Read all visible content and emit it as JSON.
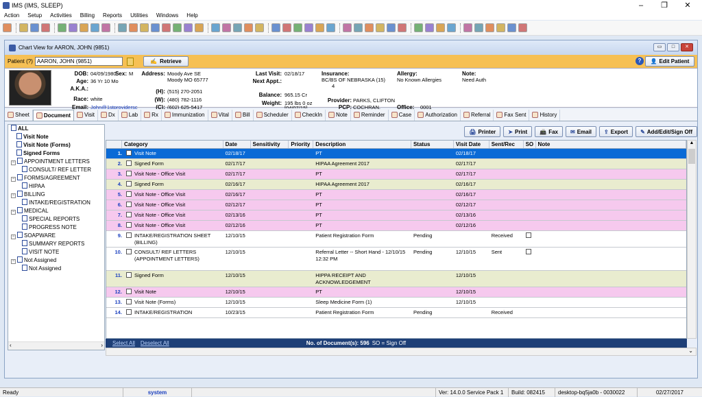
{
  "app": {
    "title": "IMS (IMS, SLEEP)"
  },
  "menu": [
    "Action",
    "Setup",
    "Activities",
    "Billing",
    "Reports",
    "Utilities",
    "Windows",
    "Help"
  ],
  "chart": {
    "title": "Chart View for AARON, JOHN  (9851)",
    "patient_label": "Patient (?)",
    "patient_value": "AARON, JOHN  (9851)",
    "retrieve": "Retrieve",
    "help": "?",
    "edit_patient": "Edit Patient"
  },
  "demo": {
    "dob_l": "DOB:",
    "dob": "04/09/1980",
    "sex_l": "Sex:",
    "sex": "M",
    "age_l": "Age:",
    "age": "36 Yr 10 Mo",
    "aka_l": "A.K.A.:",
    "race_l": "Race:",
    "race": "white",
    "email_l": "Email:",
    "email": "John@1stprovidersc",
    "addr_l": "Address:",
    "addr1": "Moody Ave SE",
    "addr2": "Moody  MO  65777",
    "h_l": "(H):",
    "h": "(515) 270-2051",
    "w_l": "(W):",
    "w": "(480) 782-1116",
    "c_l": "(C):",
    "c": "(602) 625-5417",
    "lv_l": "Last Visit:",
    "lv": "02/18/17",
    "na_l": "Next Appt.:",
    "bal_l": "Balance:",
    "bal": "965.15 Cr",
    "wt_l": "Weight:",
    "wt": "195 lbs 0 oz",
    "wt2": "[04/07/15]",
    "ins_l": "Insurance:",
    "ins": "BC/BS OF NEBRASKA  (15)",
    "ins2": "4",
    "prov_l": "Provider:",
    "prov": "PARKS, CLIFTON",
    "pcp_l": "PCP:",
    "pcp": "COCHRAN,",
    "office_l": "Office:",
    "office": "0001",
    "all_l": "Allergy:",
    "all": "No Known Allergies",
    "note_l": "Note:",
    "note": "Need Auth"
  },
  "tabs": [
    "Sheet",
    "Document",
    "Visit",
    "Dx",
    "Lab",
    "Rx",
    "Immunization",
    "Vital",
    "Bill",
    "Scheduler",
    "CheckIn",
    "Note",
    "Reminder",
    "Case",
    "Authorization",
    "Referral",
    "Fax Sent",
    "History"
  ],
  "tree": [
    {
      "t": "ALL",
      "b": true,
      "l": 0,
      "e": false
    },
    {
      "t": "Visit Note",
      "b": true,
      "l": 1,
      "e": false
    },
    {
      "t": "Visit Note (Forms)",
      "b": true,
      "l": 1,
      "e": false
    },
    {
      "t": "Signed Forms",
      "b": true,
      "l": 1,
      "e": false
    },
    {
      "t": "APPOINTMENT LETTERS",
      "b": false,
      "l": 0,
      "e": true
    },
    {
      "t": "CONSULT/ REF LETTER",
      "b": false,
      "l": 2,
      "e": false
    },
    {
      "t": "FORMS/AGREEMENT",
      "b": false,
      "l": 0,
      "e": true
    },
    {
      "t": "HIPAA",
      "b": false,
      "l": 2,
      "e": false
    },
    {
      "t": "BILLING",
      "b": false,
      "l": 0,
      "e": true
    },
    {
      "t": "INTAKE/REGISTRATION",
      "b": false,
      "l": 2,
      "e": false
    },
    {
      "t": "MEDICAL",
      "b": false,
      "l": 0,
      "e": true
    },
    {
      "t": "SPECIAL REPORTS",
      "b": false,
      "l": 2,
      "e": false
    },
    {
      "t": "PROGRESS NOTE",
      "b": false,
      "l": 2,
      "e": false
    },
    {
      "t": "SOAPWARE",
      "b": false,
      "l": 0,
      "e": true
    },
    {
      "t": "SUMMARY REPORTS",
      "b": false,
      "l": 2,
      "e": false
    },
    {
      "t": "VISIT NOTE",
      "b": false,
      "l": 2,
      "e": false
    },
    {
      "t": "Not Assigned",
      "b": false,
      "l": 0,
      "e": true
    },
    {
      "t": "Not Assigned",
      "b": false,
      "l": 2,
      "e": false
    }
  ],
  "actions": [
    "Printer",
    "Print",
    "Fax",
    "Email",
    "Export",
    "Add/Edit/Sign Off"
  ],
  "columns": [
    "Category",
    "Date",
    "Sensitivity",
    "Priority",
    "Description",
    "Status",
    "Visit Date",
    "Sent/Rec",
    "SO",
    "Note"
  ],
  "rows": [
    {
      "n": "1.",
      "cat": "Visit Note",
      "date": "02/18/17",
      "desc": "PT",
      "status": "",
      "vdate": "02/18/17",
      "sent": "",
      "so": false,
      "bg": "#0a6ad6",
      "fg": "#fff",
      "h": 15
    },
    {
      "n": "2.",
      "cat": "Signed Form",
      "date": "02/17/17",
      "desc": "HIPAA Agreement 2017",
      "status": "",
      "vdate": "02/17/17",
      "sent": "",
      "so": false,
      "bg": "#e9eccf",
      "fg": "#000",
      "h": 15
    },
    {
      "n": "3.",
      "cat": "Visit Note - Office Visit",
      "date": "02/17/17",
      "desc": "PT",
      "status": "",
      "vdate": "02/17/17",
      "sent": "",
      "so": false,
      "bg": "#f6c9ee",
      "fg": "#000",
      "h": 15
    },
    {
      "n": "4.",
      "cat": "Signed Form",
      "date": "02/16/17",
      "desc": "HIPAA Agreement 2017",
      "status": "",
      "vdate": "02/16/17",
      "sent": "",
      "so": false,
      "bg": "#e9eccf",
      "fg": "#000",
      "h": 15
    },
    {
      "n": "5.",
      "cat": "Visit Note - Office Visit",
      "date": "02/16/17",
      "desc": "PT",
      "status": "",
      "vdate": "02/16/17",
      "sent": "",
      "so": false,
      "bg": "#f6c9ee",
      "fg": "#000",
      "h": 15
    },
    {
      "n": "6.",
      "cat": "Visit Note - Office Visit",
      "date": "02/12/17",
      "desc": "PT",
      "status": "",
      "vdate": "02/12/17",
      "sent": "",
      "so": false,
      "bg": "#f6c9ee",
      "fg": "#000",
      "h": 15
    },
    {
      "n": "7.",
      "cat": "Visit Note - Office Visit",
      "date": "02/13/16",
      "desc": "PT",
      "status": "",
      "vdate": "02/13/16",
      "sent": "",
      "so": false,
      "bg": "#f6c9ee",
      "fg": "#000",
      "h": 15
    },
    {
      "n": "8.",
      "cat": "Visit Note - Office Visit",
      "date": "02/12/16",
      "desc": "PT",
      "status": "",
      "vdate": "02/12/16",
      "sent": "",
      "so": false,
      "bg": "#f6c9ee",
      "fg": "#000",
      "h": 15
    },
    {
      "n": "9.",
      "cat": "INTAKE/REGISTRATION SHEET (BILLING)",
      "date": "12/10/15",
      "desc": "Patient Registration Form",
      "status": "Pending",
      "vdate": "",
      "sent": "Received",
      "so": true,
      "bg": "#fff",
      "fg": "#000",
      "h": 24
    },
    {
      "n": "10.",
      "cat": "CONSULT/ REF LETTERS (APPOINTMENT LETTERS)",
      "date": "12/10/15",
      "desc": "Referral Letter -- Short Hand - 12/10/15 12:32 PM",
      "status": "Pending",
      "vdate": "12/10/15",
      "sent": "Sent",
      "so": true,
      "bg": "#fff",
      "fg": "#000",
      "h": 34
    },
    {
      "n": "11.",
      "cat": "Signed Form",
      "date": "12/10/15",
      "desc": "HIPPA RECEIPT AND ACKNOWLEDGEMENT",
      "status": "",
      "vdate": "12/10/15",
      "sent": "",
      "so": false,
      "bg": "#e9eccf",
      "fg": "#000",
      "h": 24
    },
    {
      "n": "12.",
      "cat": "Visit Note",
      "date": "12/10/15",
      "desc": "PT",
      "status": "",
      "vdate": "12/10/15",
      "sent": "",
      "so": false,
      "bg": "#f6c9ee",
      "fg": "#000",
      "h": 15
    },
    {
      "n": "13.",
      "cat": "Visit Note (Forms)",
      "date": "12/10/15",
      "desc": "Sleep Medicine Form (1)",
      "status": "",
      "vdate": "12/10/15",
      "sent": "",
      "so": false,
      "bg": "#fff",
      "fg": "#000",
      "h": 15
    },
    {
      "n": "14.",
      "cat": "INTAKE/REGISTRATION",
      "date": "10/23/15",
      "desc": "Patient Registration Form",
      "status": "Pending",
      "vdate": "",
      "sent": "Received",
      "so": false,
      "bg": "#fff",
      "fg": "#000",
      "h": 15
    }
  ],
  "footer": {
    "select_all": "Select All",
    "deselect_all": "Deselect All",
    "count_label": "No. of Document(s): 596",
    "so_note": "SO = Sign Off"
  },
  "status": {
    "ready": "Ready",
    "user": "system",
    "ver": "Ver: 14.0.0 Service Pack 1",
    "build": "Build: 082415",
    "host": "desktop-bq5ja0b - 0030022",
    "date": "02/27/2017"
  }
}
